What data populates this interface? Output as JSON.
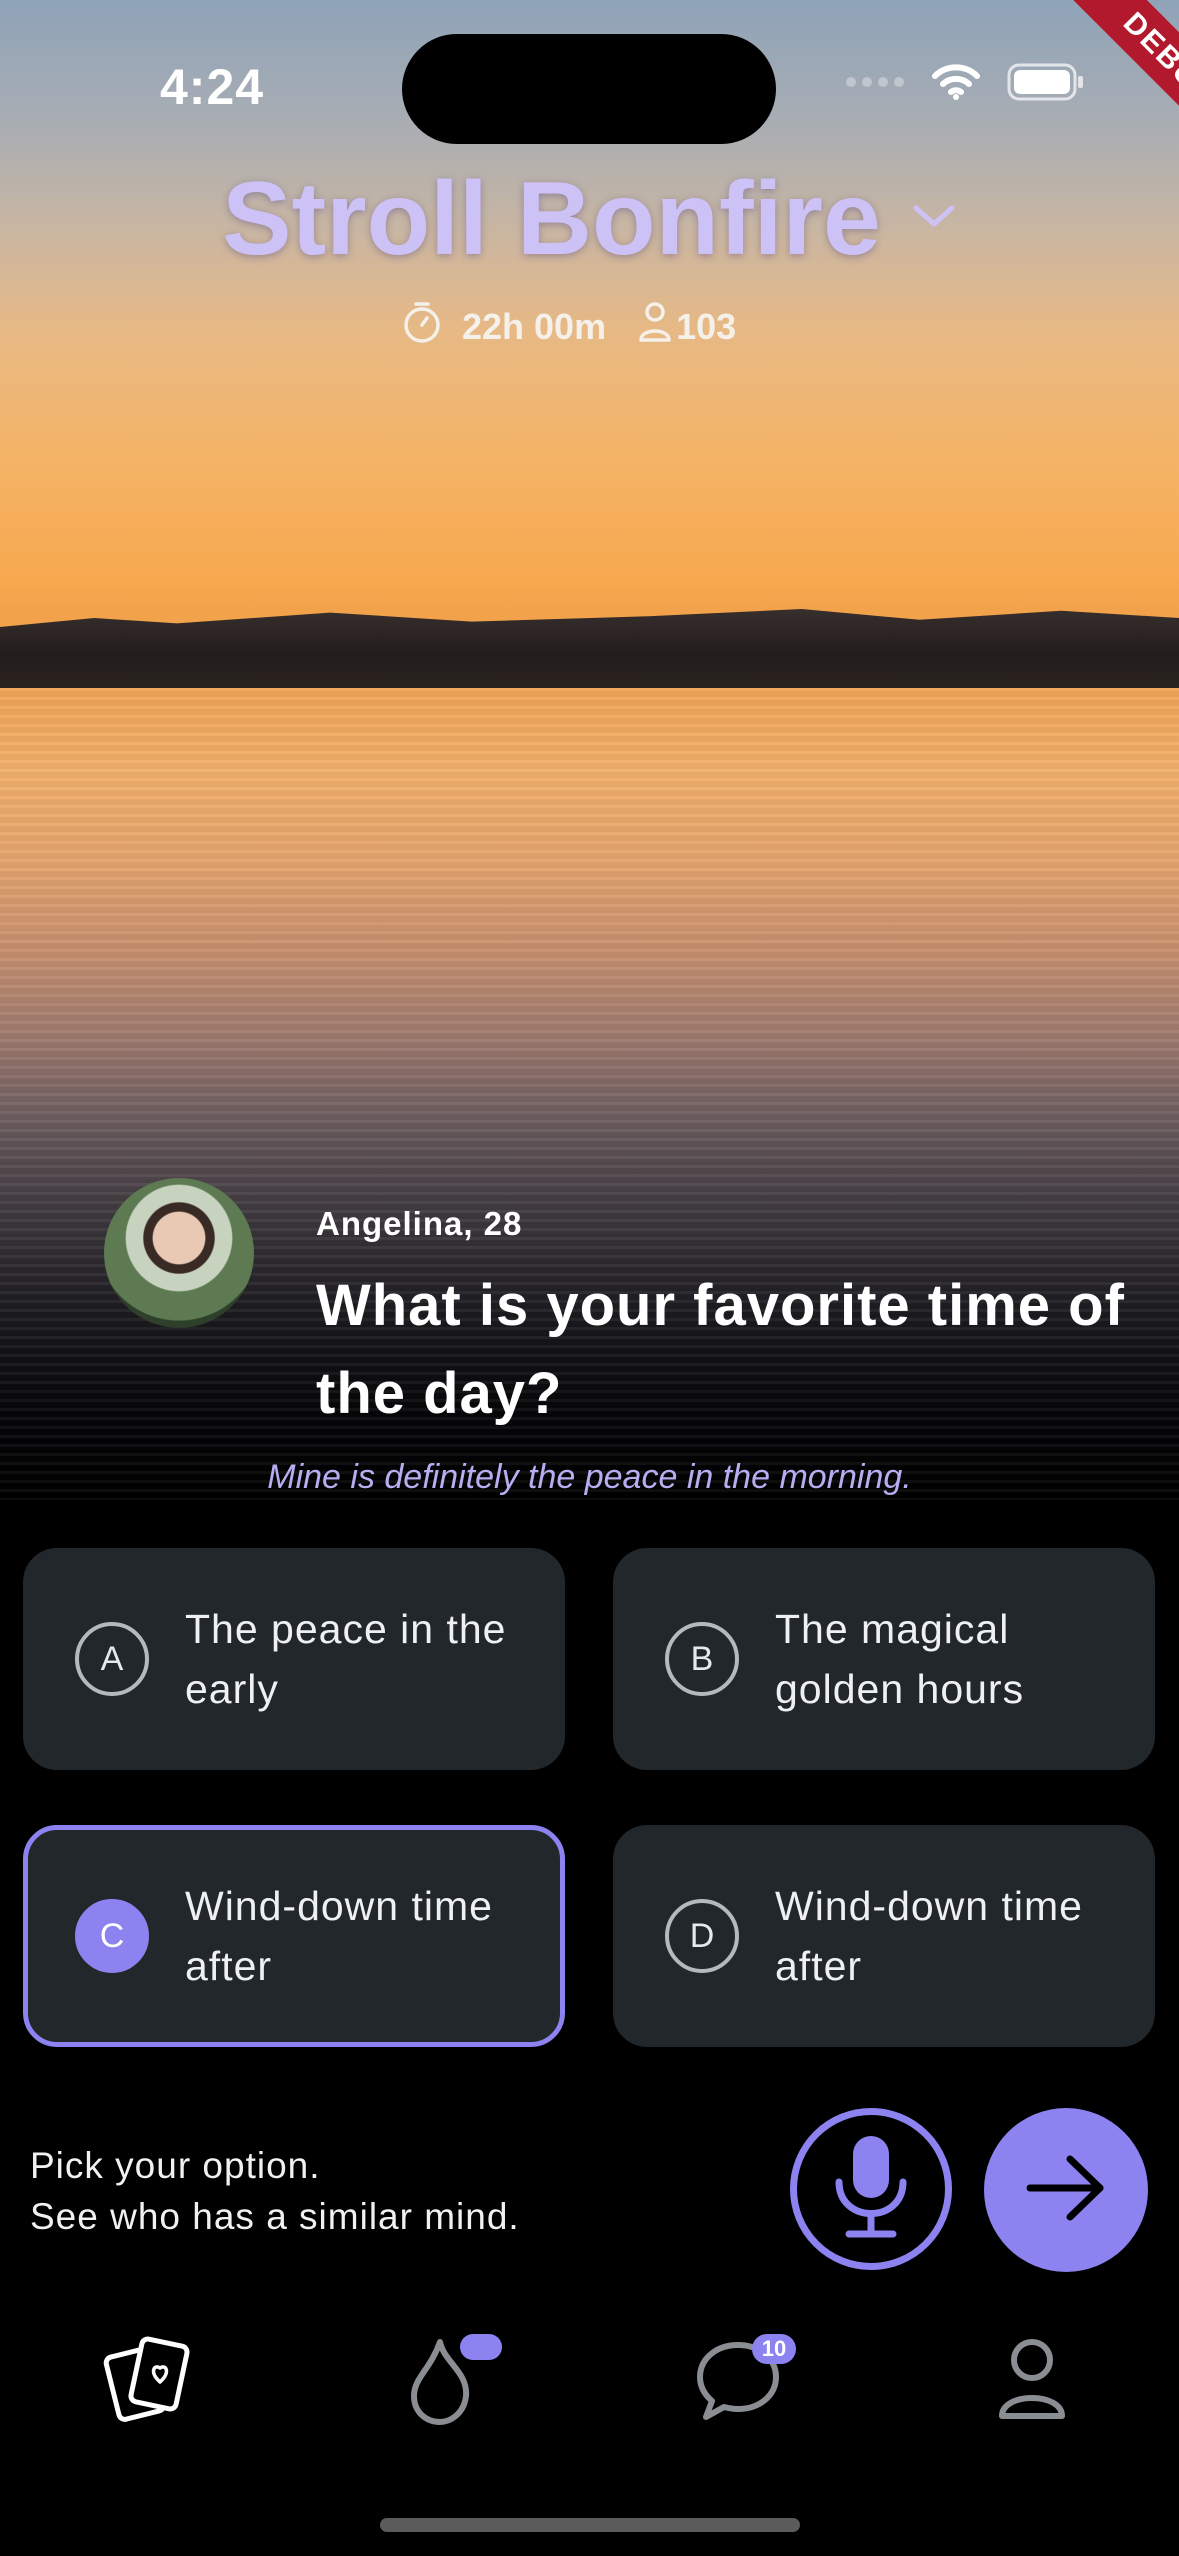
{
  "status_bar": {
    "time": "4:24",
    "debug_label": "DEBUG"
  },
  "header": {
    "title": "Stroll Bonfire",
    "timer": "22h 00m",
    "participants": "103"
  },
  "prompt": {
    "asker": "Angelina, 28",
    "question": "What is your favorite time of the day?",
    "asker_answer": "Mine is definitely the peace in the morning."
  },
  "options": [
    {
      "letter": "A",
      "text": "The peace in the early",
      "selected": false
    },
    {
      "letter": "B",
      "text": "The magical golden hours",
      "selected": false
    },
    {
      "letter": "C",
      "text": "Wind-down time after",
      "selected": true
    },
    {
      "letter": "D",
      "text": "Wind-down time after",
      "selected": false
    }
  ],
  "footer": {
    "hint_line1": "Pick your option.",
    "hint_line2": "See who has a similar mind."
  },
  "tabbar": {
    "chats_badge": "10"
  },
  "colors": {
    "accent": "#8c82f0",
    "title": "#cdc2f6",
    "card": "#22272c"
  }
}
